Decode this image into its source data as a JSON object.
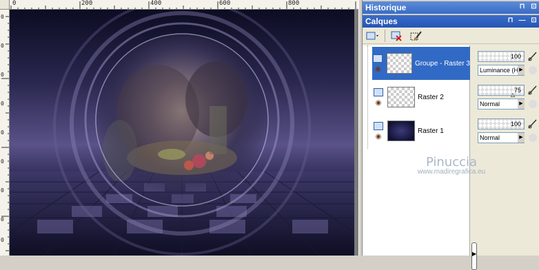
{
  "rulers": {
    "top_ticks": [
      "0",
      "200",
      "400",
      "600",
      "800"
    ],
    "left_ticks": [
      "0",
      "0",
      "0",
      "0",
      "0",
      "0",
      "0",
      "0",
      "0",
      "0"
    ]
  },
  "panels": {
    "historique": {
      "title": "Historique",
      "btn_pin": "⊓",
      "btn_close": "⊡"
    },
    "calques": {
      "title": "Calques",
      "btn_pin": "⊓",
      "btn_min": "—",
      "btn_close": "⊡"
    }
  },
  "layers": [
    {
      "name": "Groupe - Raster 3",
      "opacity": "100",
      "blend": "Luminance (H)",
      "selected": true
    },
    {
      "name": "Raster 2",
      "opacity": "75",
      "blend": "Normal",
      "selected": false
    },
    {
      "name": "Raster 1",
      "opacity": "100",
      "blend": "Normal",
      "selected": false
    }
  ],
  "watermark": {
    "name": "Pinuccia",
    "url": "www.madiregrafica.eu"
  },
  "colors": {
    "title_blue": "#3a6bc4",
    "selection_blue": "#316ac5",
    "panel_bg": "#ece9d8"
  }
}
